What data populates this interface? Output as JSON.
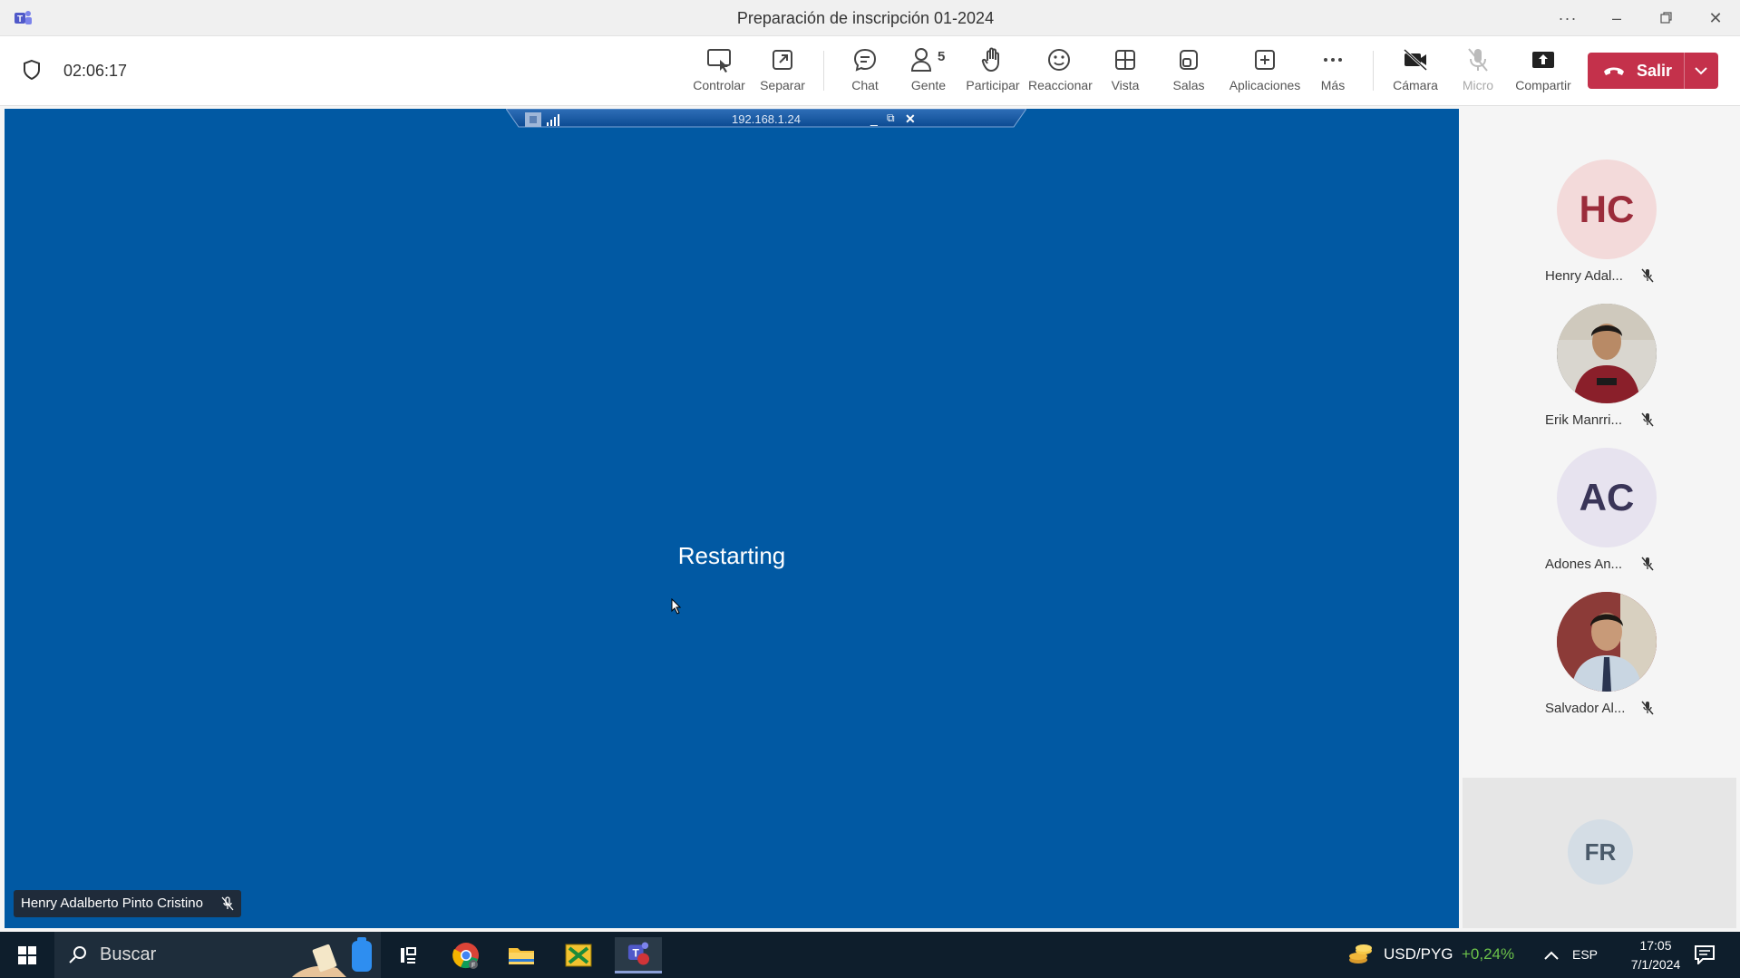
{
  "window": {
    "title": "Preparación de inscripción 01-2024",
    "app_icon": "teams-icon",
    "controls": [
      "more-icon",
      "minimize-icon",
      "restore-icon",
      "close-icon"
    ]
  },
  "meeting": {
    "timer": "02:06:17",
    "people_count": "5",
    "toolbar": {
      "controlar": "Controlar",
      "separar": "Separar",
      "chat": "Chat",
      "gente": "Gente",
      "participar": "Participar",
      "reaccionar": "Reaccionar",
      "vista": "Vista",
      "salas": "Salas",
      "aplicaciones": "Aplicaciones",
      "mas": "Más",
      "camara": "Cámara",
      "micro": "Micro",
      "compartir": "Compartir",
      "salir": "Salir"
    },
    "leave_color": "#c4314b"
  },
  "shared_screen": {
    "remote_ip": "192.168.1.24",
    "status": "Restarting",
    "background_color": "#0159a3",
    "presenter": "Henry Adalberto Pinto Cristino"
  },
  "participants": [
    {
      "initials": "HC",
      "name": "Henry Adal...",
      "muted": true,
      "bg": "#f3dada",
      "fg": "#9b2c3b"
    },
    {
      "initials": "",
      "name": "Erik Manrri...",
      "muted": true,
      "photo": true
    },
    {
      "initials": "AC",
      "name": "Adones An...",
      "muted": true,
      "bg": "#e7e3ef",
      "fg": "#3a3558"
    },
    {
      "initials": "",
      "name": "Salvador Al...",
      "muted": true,
      "photo": true
    }
  ],
  "self_tile": {
    "initials": "FR"
  },
  "taskbar": {
    "search_label": "Buscar",
    "ticker_label": "USD/PYG",
    "ticker_change": "+0,24%",
    "language": "ESP",
    "time": "17:05",
    "date": "7/1/2024"
  }
}
